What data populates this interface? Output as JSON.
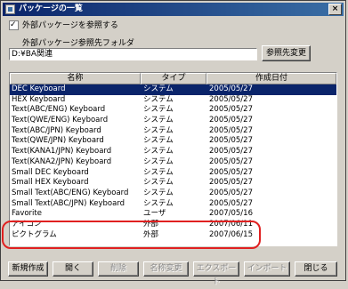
{
  "window": {
    "title": "パッケージの一覧",
    "close_glyph": "×"
  },
  "external": {
    "checkbox_label": "外部パッケージを参照する",
    "checked": true,
    "folder_label": "外部パッケージ参照先フォルダ",
    "folder_value": "D:¥BA関連",
    "change_button": "参照先変更"
  },
  "table": {
    "headers": {
      "name": "名称",
      "type": "タイプ",
      "date": "作成日付"
    },
    "rows": [
      {
        "name": "DEC Keyboard",
        "type": "システム",
        "date": "2005/05/27",
        "selected": true
      },
      {
        "name": "HEX Keyboard",
        "type": "システム",
        "date": "2005/05/27"
      },
      {
        "name": "Text(ABC/ENG) Keyboard",
        "type": "システム",
        "date": "2005/05/27"
      },
      {
        "name": "Text(QWE/ENG) Keyboard",
        "type": "システム",
        "date": "2005/05/27"
      },
      {
        "name": "Text(ABC/JPN) Keyboard",
        "type": "システム",
        "date": "2005/05/27"
      },
      {
        "name": "Text(QWE/JPN) Keyboard",
        "type": "システム",
        "date": "2005/05/27"
      },
      {
        "name": "Text(KANA1/JPN) Keyboard",
        "type": "システム",
        "date": "2005/05/27"
      },
      {
        "name": "Text(KANA2/JPN) Keyboard",
        "type": "システム",
        "date": "2005/05/27"
      },
      {
        "name": "Small DEC Keyboard",
        "type": "システム",
        "date": "2005/05/27"
      },
      {
        "name": "Small HEX Keyboard",
        "type": "システム",
        "date": "2005/05/27"
      },
      {
        "name": "Small Text(ABC/ENG) Keyboard",
        "type": "システム",
        "date": "2005/05/27"
      },
      {
        "name": "Small Text(ABC/JPN) Keyboard",
        "type": "システム",
        "date": "2005/05/27"
      },
      {
        "name": "Favorite",
        "type": "ユーザ",
        "date": "2007/05/16"
      },
      {
        "name": "アイコン",
        "type": "外部",
        "date": "2007/06/11"
      },
      {
        "name": "ピクトグラム",
        "type": "外部",
        "date": "2007/06/15"
      }
    ]
  },
  "buttons": {
    "new": "新規作成",
    "open": "開く",
    "delete": "削除",
    "rename": "名称変更",
    "export": "エクスポート",
    "import": "インポート",
    "close": "閉じる"
  },
  "colors": {
    "title_bar": "#0a246a",
    "selection": "#0a246a",
    "highlight": "#e02020",
    "face": "#d4d0c8"
  }
}
